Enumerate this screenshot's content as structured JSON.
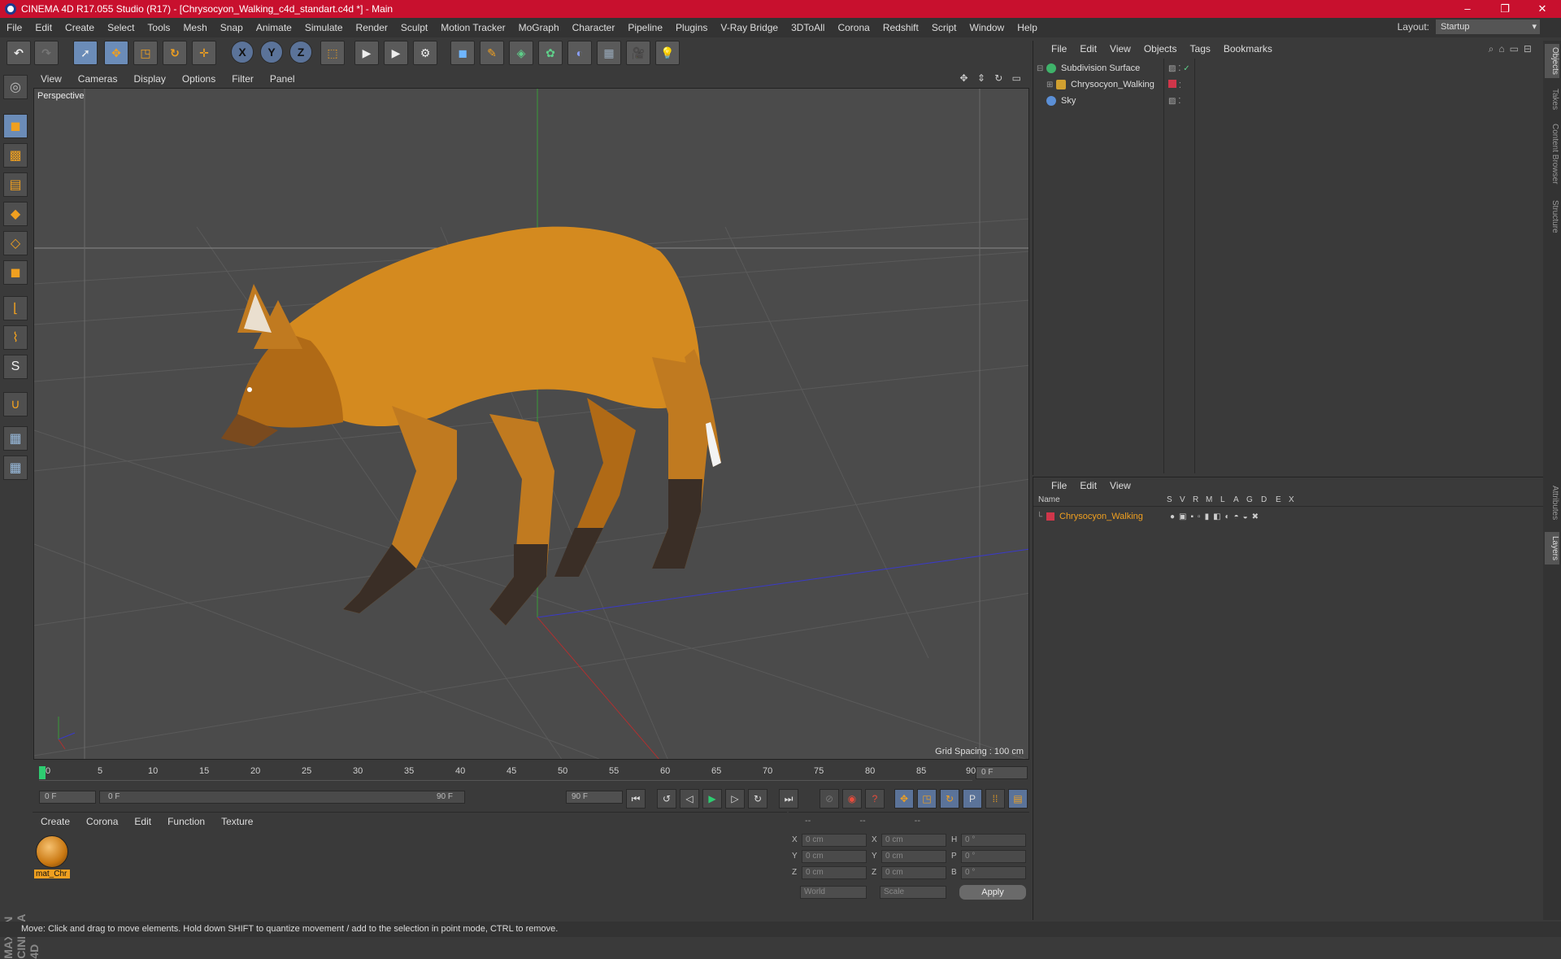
{
  "window": {
    "title": "CINEMA 4D R17.055 Studio (R17) - [Chrysocyon_Walking_c4d_standart.c4d *] - Main",
    "controls": [
      "–",
      "❐",
      "✕"
    ]
  },
  "menubar": {
    "items": [
      "File",
      "Edit",
      "Create",
      "Select",
      "Tools",
      "Mesh",
      "Snap",
      "Animate",
      "Simulate",
      "Render",
      "Sculpt",
      "Motion Tracker",
      "MoGraph",
      "Character",
      "Pipeline",
      "Plugins",
      "V-Ray Bridge",
      "3DToAll",
      "Corona",
      "Redshift",
      "Script",
      "Window",
      "Help"
    ],
    "layout_label": "Layout:",
    "layout_value": "Startup"
  },
  "toolbar": {
    "axes": [
      "X",
      "Y",
      "Z"
    ]
  },
  "viewport": {
    "menu": [
      "View",
      "Cameras",
      "Display",
      "Options",
      "Filter",
      "Panel"
    ],
    "label": "Perspective",
    "grid_spacing": "Grid Spacing : 100 cm",
    "nav_icons": "✥ ⇕ ↻ ▭"
  },
  "timeline": {
    "ticks": [
      "0",
      "5",
      "10",
      "15",
      "20",
      "25",
      "30",
      "35",
      "40",
      "45",
      "50",
      "55",
      "60",
      "65",
      "70",
      "75",
      "80",
      "85",
      "90"
    ],
    "current_frame": "0 F",
    "start": "0 F",
    "range_start": "0 F",
    "range_end": "90 F",
    "end": "90 F"
  },
  "material_panel": {
    "menu": [
      "Create",
      "Corona",
      "Edit",
      "Function",
      "Texture"
    ],
    "material_name": "mat_Chr"
  },
  "coord_panel": {
    "headers": [
      "--",
      "--",
      "--"
    ],
    "rows": [
      {
        "a": "X",
        "v1": "0 cm",
        "b": "X",
        "v2": "0 cm",
        "c": "H",
        "v3": "0 °"
      },
      {
        "a": "Y",
        "v1": "0 cm",
        "b": "Y",
        "v2": "0 cm",
        "c": "P",
        "v3": "0 °"
      },
      {
        "a": "Z",
        "v1": "0 cm",
        "b": "Z",
        "v2": "0 cm",
        "c": "B",
        "v3": "0 °"
      }
    ],
    "world": "World",
    "scale": "Scale",
    "apply": "Apply"
  },
  "object_manager": {
    "menu": [
      "File",
      "Edit",
      "View",
      "Objects",
      "Tags",
      "Bookmarks"
    ],
    "objects": [
      {
        "name": "Subdivision Surface",
        "color": "#3fb36a"
      },
      {
        "name": "Chrysocyon_Walking",
        "color": "#d0a030"
      },
      {
        "name": "Sky",
        "color": "#5b8fd6"
      }
    ]
  },
  "layer_manager": {
    "menu": [
      "File",
      "Edit",
      "View"
    ],
    "columns": [
      "Name",
      "S",
      "V",
      "R",
      "M",
      "L",
      "A",
      "G",
      "D",
      "E",
      "X"
    ],
    "layers": [
      {
        "name": "Chrysocyon_Walking",
        "color": "#d0364a"
      }
    ]
  },
  "right_tabs": [
    "Objects",
    "Takes",
    "Content Browser",
    "Structure",
    "Attributes",
    "Layers"
  ],
  "status": "Move: Click and drag to move elements. Hold down SHIFT to quantize movement / add to the selection in point mode, CTRL to remove.",
  "brand": "MAXON CINEMA 4D"
}
